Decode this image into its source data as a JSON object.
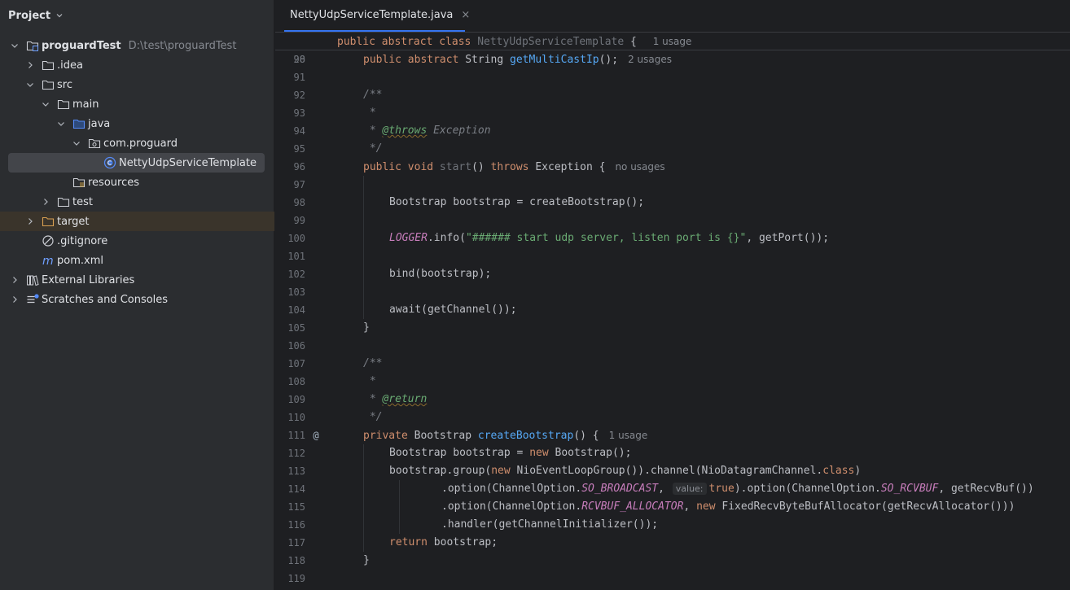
{
  "project_panel": {
    "title": "Project",
    "tree": [
      {
        "label": "proguardTest",
        "sub": "D:\\test\\proguardTest",
        "level": 0,
        "expanded": true,
        "icon": "module-folder",
        "bold": true
      },
      {
        "label": ".idea",
        "level": 1,
        "expanded": false,
        "icon": "folder"
      },
      {
        "label": "src",
        "level": 1,
        "expanded": true,
        "icon": "folder"
      },
      {
        "label": "main",
        "level": 2,
        "expanded": true,
        "icon": "folder"
      },
      {
        "label": "java",
        "level": 3,
        "expanded": true,
        "icon": "source-folder"
      },
      {
        "label": "com.proguard",
        "level": 4,
        "expanded": true,
        "icon": "package"
      },
      {
        "label": "NettyUdpServiceTemplate",
        "level": 5,
        "icon": "java-class",
        "selected": true
      },
      {
        "label": "resources",
        "level": 3,
        "icon": "resources-folder"
      },
      {
        "label": "test",
        "level": 2,
        "expanded": false,
        "icon": "folder"
      },
      {
        "label": "target",
        "level": 1,
        "expanded": false,
        "icon": "excluded-folder",
        "excluded": true
      },
      {
        "label": ".gitignore",
        "level": 1,
        "icon": "ignore-file"
      },
      {
        "label": "pom.xml",
        "level": 1,
        "icon": "maven-file"
      },
      {
        "label": "External Libraries",
        "level": 0,
        "expanded": false,
        "icon": "libraries"
      },
      {
        "label": "Scratches and Consoles",
        "level": 0,
        "expanded": false,
        "icon": "scratches"
      }
    ]
  },
  "editor": {
    "tab": {
      "label": "NettyUdpServiceTemplate.java",
      "close": "×"
    },
    "sticky": {
      "num": "28",
      "tokens": [
        [
          "kw",
          "public abstract class "
        ],
        [
          "unused",
          "NettyUdpServiceTemplate"
        ],
        [
          "p",
          " { "
        ],
        [
          "hint",
          "1 usage"
        ]
      ]
    },
    "lines": [
      {
        "num": "90",
        "indent": 1,
        "tokens": [
          [
            "kw",
            "public abstract "
          ],
          [
            "p",
            "String "
          ],
          [
            "fn",
            "getMultiCastIp"
          ],
          [
            "p",
            "();"
          ],
          [
            "hint",
            "2 usages"
          ]
        ]
      },
      {
        "num": "91",
        "indent": 0,
        "tokens": []
      },
      {
        "num": "92",
        "indent": 1,
        "tokens": [
          [
            "cm",
            "/**"
          ]
        ]
      },
      {
        "num": "93",
        "indent": 1,
        "tokens": [
          [
            "cm",
            " *"
          ]
        ]
      },
      {
        "num": "94",
        "indent": 1,
        "tokens": [
          [
            "cm",
            " * "
          ],
          [
            "cmtag",
            "@throws"
          ],
          [
            "cm",
            " Exception"
          ]
        ]
      },
      {
        "num": "95",
        "indent": 1,
        "tokens": [
          [
            "cm",
            " */"
          ]
        ]
      },
      {
        "num": "96",
        "indent": 1,
        "tokens": [
          [
            "kw",
            "public void "
          ],
          [
            "unused",
            "start"
          ],
          [
            "p",
            "() "
          ],
          [
            "kw",
            "throws "
          ],
          [
            "p",
            "Exception {"
          ],
          [
            "hint",
            "no usages"
          ]
        ]
      },
      {
        "num": "97",
        "indent": 0,
        "tokens": []
      },
      {
        "num": "98",
        "indent": 2,
        "tokens": [
          [
            "p",
            "Bootstrap bootstrap = createBootstrap();"
          ]
        ]
      },
      {
        "num": "99",
        "indent": 0,
        "tokens": []
      },
      {
        "num": "100",
        "indent": 2,
        "tokens": [
          [
            "const",
            "LOGGER"
          ],
          [
            "p",
            ".info("
          ],
          [
            "str",
            "\"###### start udp server, listen port is {}\""
          ],
          [
            "p",
            ", getPort());"
          ]
        ]
      },
      {
        "num": "101",
        "indent": 0,
        "tokens": []
      },
      {
        "num": "102",
        "indent": 2,
        "tokens": [
          [
            "p",
            "bind(bootstrap);"
          ]
        ]
      },
      {
        "num": "103",
        "indent": 0,
        "tokens": []
      },
      {
        "num": "104",
        "indent": 2,
        "tokens": [
          [
            "p",
            "await(getChannel());"
          ]
        ]
      },
      {
        "num": "105",
        "indent": 1,
        "tokens": [
          [
            "p",
            "}"
          ]
        ]
      },
      {
        "num": "106",
        "indent": 0,
        "tokens": []
      },
      {
        "num": "107",
        "indent": 1,
        "tokens": [
          [
            "cm",
            "/**"
          ]
        ]
      },
      {
        "num": "108",
        "indent": 1,
        "tokens": [
          [
            "cm",
            " *"
          ]
        ]
      },
      {
        "num": "109",
        "indent": 1,
        "tokens": [
          [
            "cm",
            " * "
          ],
          [
            "cmtag",
            "@return"
          ]
        ]
      },
      {
        "num": "110",
        "indent": 1,
        "tokens": [
          [
            "cm",
            " */"
          ]
        ]
      },
      {
        "num": "111",
        "indent": 1,
        "mark": "@",
        "tokens": [
          [
            "kw",
            "private "
          ],
          [
            "p",
            "Bootstrap "
          ],
          [
            "fn",
            "createBootstrap"
          ],
          [
            "p",
            "() {"
          ],
          [
            "hint",
            "1 usage"
          ]
        ]
      },
      {
        "num": "112",
        "indent": 2,
        "tokens": [
          [
            "p",
            "Bootstrap bootstrap = "
          ],
          [
            "kw",
            "new "
          ],
          [
            "p",
            "Bootstrap();"
          ]
        ]
      },
      {
        "num": "113",
        "indent": 2,
        "tokens": [
          [
            "p",
            "bootstrap.group("
          ],
          [
            "kw",
            "new "
          ],
          [
            "p",
            "NioEventLoopGroup()).channel(NioDatagramChannel."
          ],
          [
            "kw",
            "class"
          ],
          [
            "p",
            ")"
          ]
        ]
      },
      {
        "num": "114",
        "indent": 4,
        "tokens": [
          [
            "p",
            ".option(ChannelOption."
          ],
          [
            "const",
            "SO_BROADCAST"
          ],
          [
            "p",
            ", "
          ],
          [
            "phint",
            "value:"
          ],
          [
            "kw",
            "true"
          ],
          [
            "p",
            ").option(ChannelOption."
          ],
          [
            "const",
            "SO_RCVBUF"
          ],
          [
            "p",
            ", getRecvBuf())"
          ]
        ]
      },
      {
        "num": "115",
        "indent": 4,
        "tokens": [
          [
            "p",
            ".option(ChannelOption."
          ],
          [
            "const",
            "RCVBUF_ALLOCATOR"
          ],
          [
            "p",
            ", "
          ],
          [
            "kw",
            "new "
          ],
          [
            "p",
            "FixedRecvByteBufAllocator(getRecvAllocator()))"
          ]
        ]
      },
      {
        "num": "116",
        "indent": 4,
        "tokens": [
          [
            "p",
            ".handler(getChannelInitializer());"
          ]
        ]
      },
      {
        "num": "117",
        "indent": 2,
        "tokens": [
          [
            "kw",
            "return "
          ],
          [
            "p",
            "bootstrap;"
          ]
        ]
      },
      {
        "num": "118",
        "indent": 1,
        "tokens": [
          [
            "p",
            "}"
          ]
        ]
      },
      {
        "num": "119",
        "indent": 0,
        "tokens": []
      }
    ]
  }
}
